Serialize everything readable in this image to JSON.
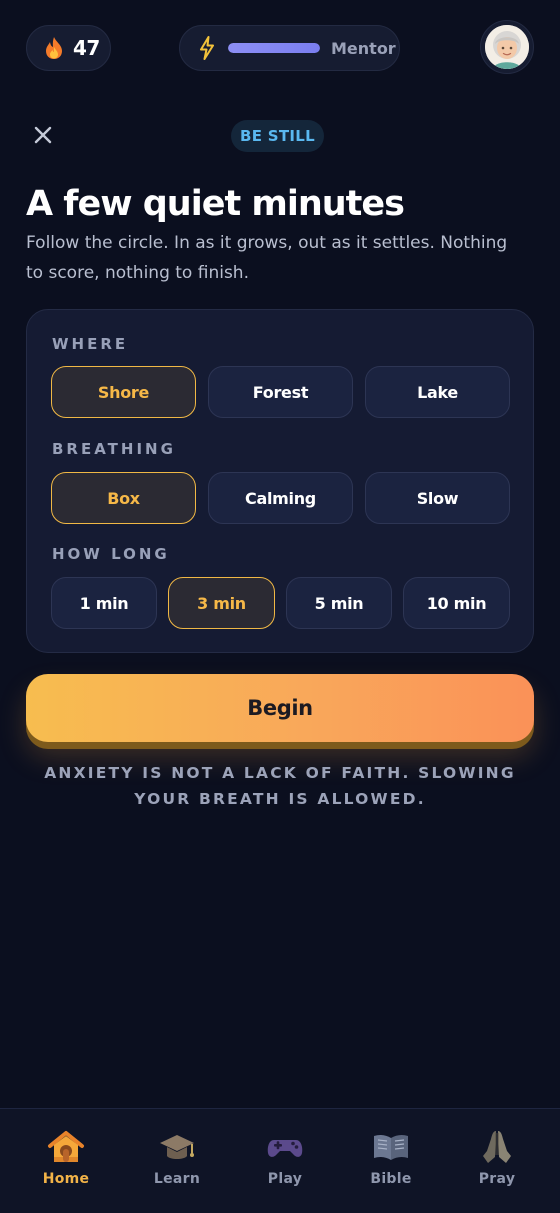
{
  "topbar": {
    "streak_count": "47",
    "xp_progress": 1.0,
    "rank_label": "Mentor"
  },
  "header": {
    "tag": "BE STILL",
    "title": "A few quiet minutes",
    "subtitle": "Follow the circle. In as it grows, out as it settles. Nothing to score, nothing to finish."
  },
  "where": {
    "label": "WHERE",
    "options": [
      "Shore",
      "Forest",
      "Lake"
    ],
    "selected": "Shore"
  },
  "breathing": {
    "label": "BREATHING",
    "options": [
      "Box",
      "Calming",
      "Slow"
    ],
    "selected": "Box"
  },
  "duration": {
    "label": "HOW LONG",
    "options": [
      "1 min",
      "3 min",
      "5 min",
      "10 min"
    ],
    "selected": "3 min"
  },
  "begin_label": "Begin",
  "note": "ANXIETY IS NOT A LACK OF FAITH. SLOWING YOUR BREATH IS ALLOWED.",
  "nav": {
    "items": [
      {
        "label": "Home",
        "icon": "house-icon"
      },
      {
        "label": "Learn",
        "icon": "graduation-cap-icon"
      },
      {
        "label": "Play",
        "icon": "game-controller-icon"
      },
      {
        "label": "Bible",
        "icon": "open-book-icon"
      },
      {
        "label": "Pray",
        "icon": "praying-hands-icon"
      }
    ],
    "active": "Home"
  },
  "colors": {
    "background": "#0b0f1f",
    "accent": "#f2b348",
    "tag_text": "#5ab8f0",
    "xp_bar": "#8d8ff5"
  }
}
